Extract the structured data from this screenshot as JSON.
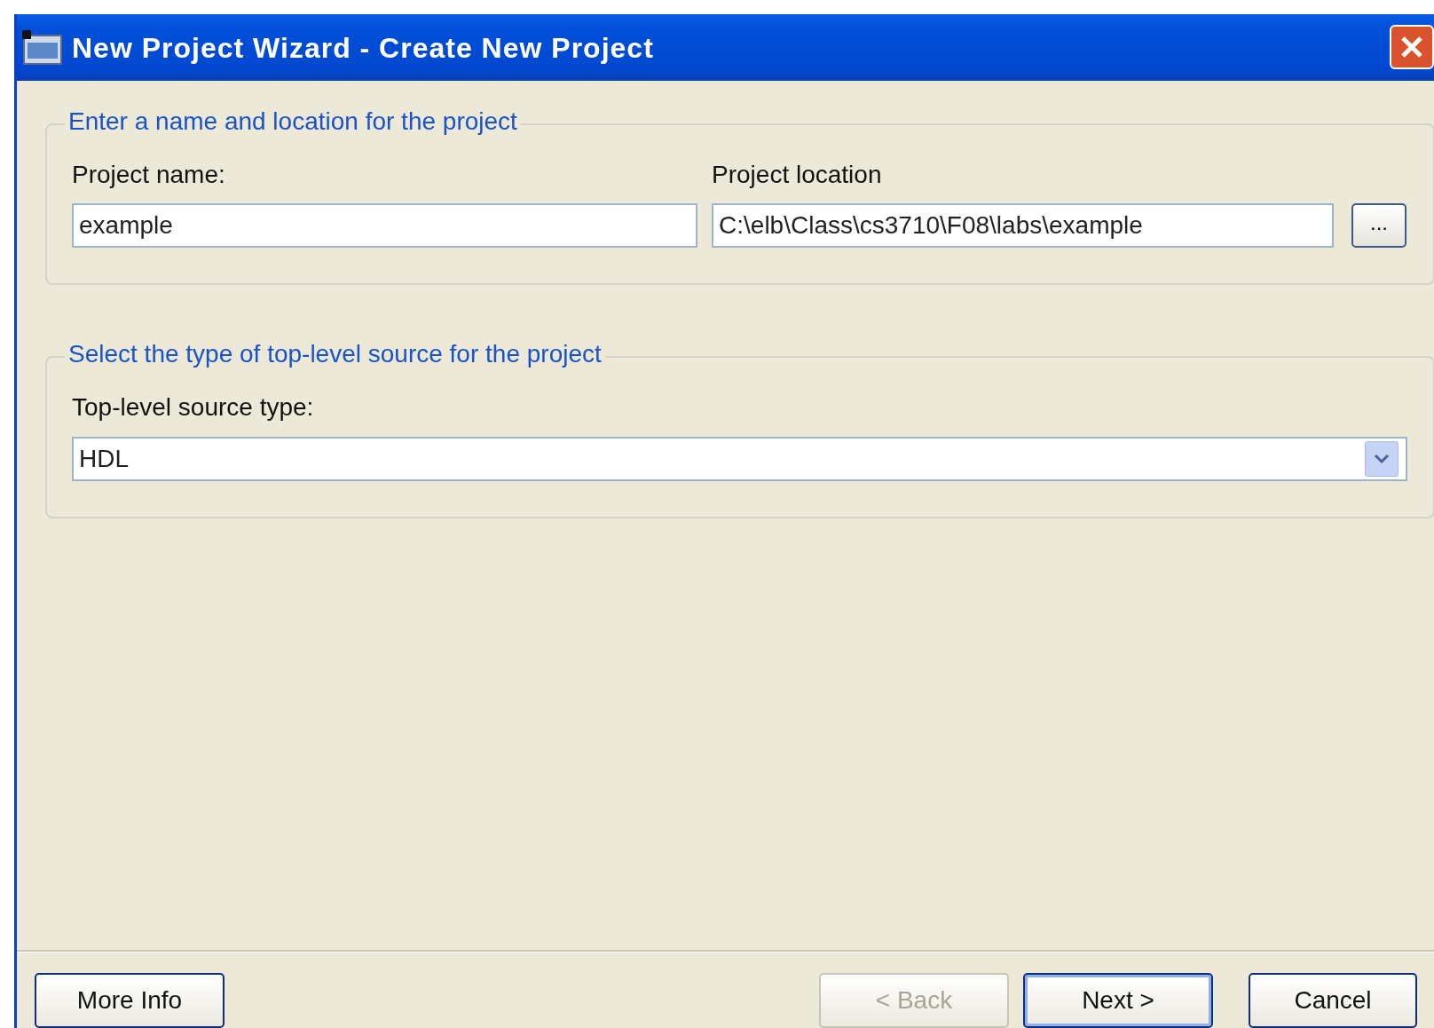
{
  "window": {
    "title": "New Project Wizard - Create New Project"
  },
  "groups": [
    {
      "title": "Enter a name and location for the project",
      "kind": "name-location",
      "fields": [
        {
          "label": "Project name:",
          "value": "example"
        },
        {
          "label": "Project location",
          "value": "C:\\elb\\Class\\cs3710\\F08\\labs\\example",
          "browse": "..."
        }
      ]
    },
    {
      "title": "Select the type of top-level source for the project",
      "kind": "source-type",
      "fields": [
        {
          "label": "Top-level source type:",
          "value": "HDL"
        }
      ]
    }
  ],
  "buttons": [
    {
      "label": "More Info",
      "disabled": false,
      "default": false
    },
    {
      "label": "< Back",
      "disabled": true,
      "default": false
    },
    {
      "label": "Next >",
      "disabled": false,
      "default": true
    },
    {
      "label": "Cancel",
      "disabled": false,
      "default": false
    }
  ]
}
